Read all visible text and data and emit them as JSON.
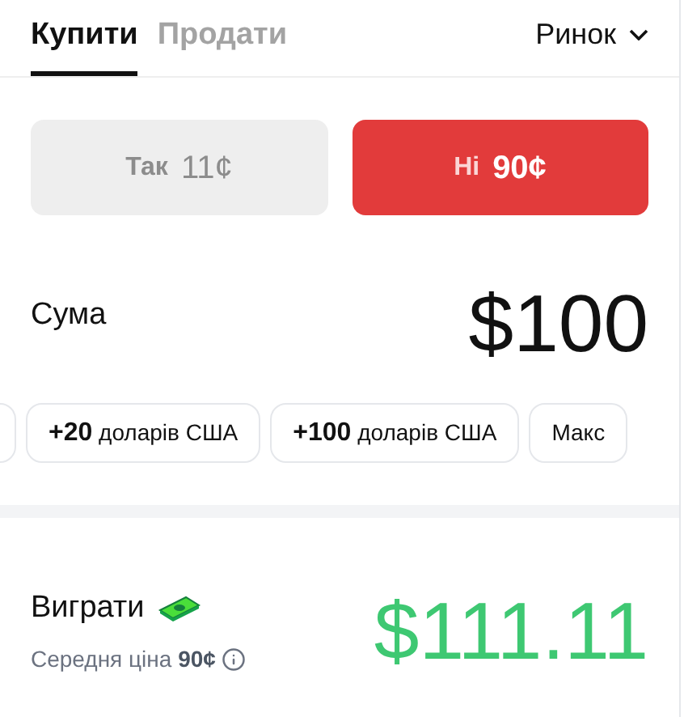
{
  "tabs": [
    {
      "label": "Купити",
      "selected": true
    },
    {
      "label": "Продати",
      "selected": false
    }
  ],
  "order_type": {
    "label": "Ринок"
  },
  "outcomes": [
    {
      "label": "Так",
      "price": "11¢",
      "selected": false
    },
    {
      "label": "Ні",
      "price": "90¢",
      "selected": true
    }
  ],
  "amount": {
    "label": "Сума",
    "value": "$100"
  },
  "presets": [
    {
      "amount": "+20",
      "unit": "доларів США"
    },
    {
      "amount": "+100",
      "unit": "доларів США"
    },
    {
      "amount": "Макс"
    }
  ],
  "payout": {
    "label": "Виграти",
    "avg_label": "Середня ціна",
    "avg_price": "90¢",
    "value": "$111.11"
  }
}
